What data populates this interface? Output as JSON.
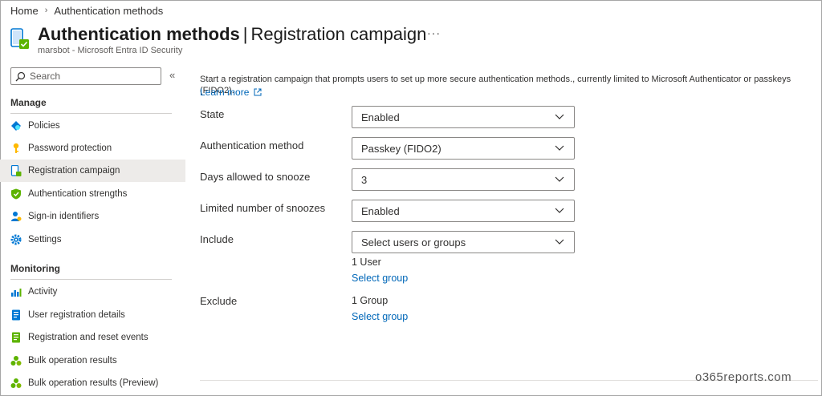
{
  "breadcrumb": {
    "home": "Home",
    "separator": "›",
    "current": "Authentication methods"
  },
  "header": {
    "title_main": "Authentication methods",
    "title_sep": "|",
    "title_sub": "Registration campaign",
    "more": "···",
    "subtitle": "marsbot - Microsoft Entra ID Security"
  },
  "sidebar": {
    "search_placeholder": "Search",
    "collapse": "«",
    "manage_label": "Manage",
    "manage_items": [
      {
        "label": "Policies",
        "icon": "policies-icon"
      },
      {
        "label": "Password protection",
        "icon": "key-icon"
      },
      {
        "label": "Registration campaign",
        "icon": "device-icon"
      },
      {
        "label": "Authentication strengths",
        "icon": "shield-icon"
      },
      {
        "label": "Sign-in identifiers",
        "icon": "user-icon"
      },
      {
        "label": "Settings",
        "icon": "gear-icon"
      }
    ],
    "monitoring_label": "Monitoring",
    "monitoring_items": [
      {
        "label": "Activity",
        "icon": "chart-icon"
      },
      {
        "label": "User registration details",
        "icon": "document-icon"
      },
      {
        "label": "Registration and reset events",
        "icon": "log-icon"
      },
      {
        "label": "Bulk operation results",
        "icon": "group-icon"
      },
      {
        "label": "Bulk operation results (Preview)",
        "icon": "group-icon"
      }
    ],
    "selected": "Registration campaign"
  },
  "main": {
    "description": "Start a registration campaign that prompts users to set up more secure authentication methods., currently limited to Microsoft Authenticator or passkeys (FIDO2).",
    "learn_more": "Learn more",
    "fields": {
      "state": {
        "label": "State",
        "value": "Enabled"
      },
      "auth_method": {
        "label": "Authentication method",
        "value": "Passkey (FIDO2)"
      },
      "snooze_days": {
        "label": "Days allowed to snooze",
        "value": "3"
      },
      "limited_snoozes": {
        "label": "Limited number of snoozes",
        "value": "Enabled"
      },
      "include": {
        "label": "Include",
        "value": "Select users or groups",
        "count": "1 User",
        "link": "Select group"
      },
      "exclude": {
        "label": "Exclude",
        "count": "1 Group",
        "link": "Select group"
      }
    }
  },
  "watermark": "o365reports.com",
  "colors": {
    "link": "#0067b8",
    "selected_bg": "#edebe9",
    "border": "#8a8886"
  }
}
